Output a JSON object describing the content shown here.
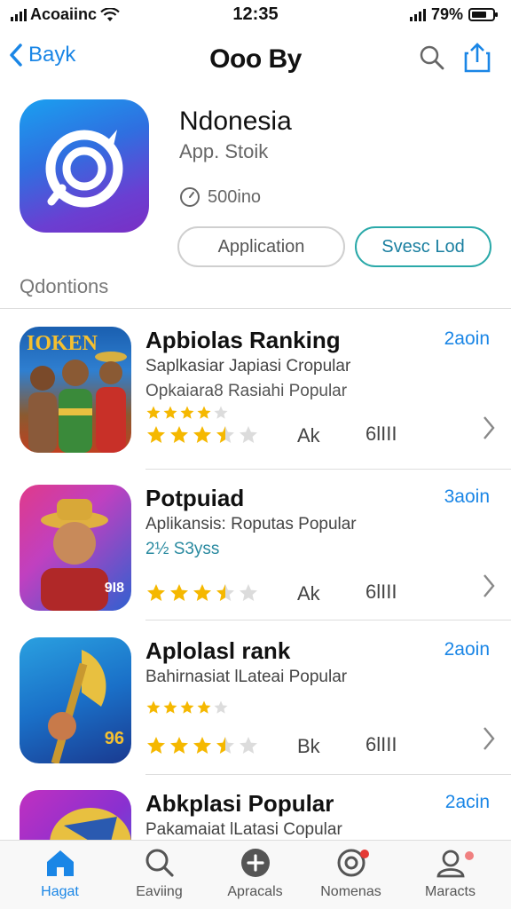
{
  "status": {
    "carrier": "Acoaiinc",
    "time": "12:35",
    "battery": "79%"
  },
  "nav": {
    "back_label": "Bayk",
    "title": "Ooo By"
  },
  "app": {
    "name": "Ndonesia",
    "subtitle": "App. Stoik",
    "size": "500ino",
    "button_primary": "Application",
    "button_download": "Svesc Lod",
    "section": "Qdontions"
  },
  "rows": [
    {
      "name": "Apbiolas Ranking",
      "line1": "Saplkasiar Japiasi Cropular",
      "line2": "Opkaiara8 Rasiahi Popular",
      "meta1": "Ak",
      "meta2": "6lIII",
      "time": "2aoin",
      "small_rating": 4,
      "rating": 3.5,
      "thumb_text": "IOKEN"
    },
    {
      "name": "Potpuiad",
      "line1": "Aplikansis: Roputas Popular",
      "line2": "2½ S3yss",
      "meta1": "Ak",
      "meta2": "6lIII",
      "time": "3aoin",
      "rating": 3.5,
      "thumb_text": "9I8"
    },
    {
      "name": "Aplolasl rank",
      "line1": "Bahirnasiat lLateai Popular",
      "line2": "",
      "meta1": "Bk",
      "meta2": "6lIII",
      "time": "2aoin",
      "small_rating": 4,
      "rating": 3.5,
      "thumb_text": "96"
    },
    {
      "name": "Abkplasi Popular",
      "line1": "Pakamaiat lLatasi Copular",
      "time": "2acin"
    }
  ],
  "tabs": [
    {
      "label": "Hagat",
      "icon": "home-icon"
    },
    {
      "label": "Eaviing",
      "icon": "search-icon"
    },
    {
      "label": "Apracals",
      "icon": "plus-circle-icon"
    },
    {
      "label": "Nomenas",
      "icon": "target-icon"
    },
    {
      "label": "Maracts",
      "icon": "person-icon"
    }
  ],
  "colors": {
    "accent": "#1a86e6",
    "star": "#f5b800",
    "teal": "#2aa9a9"
  }
}
